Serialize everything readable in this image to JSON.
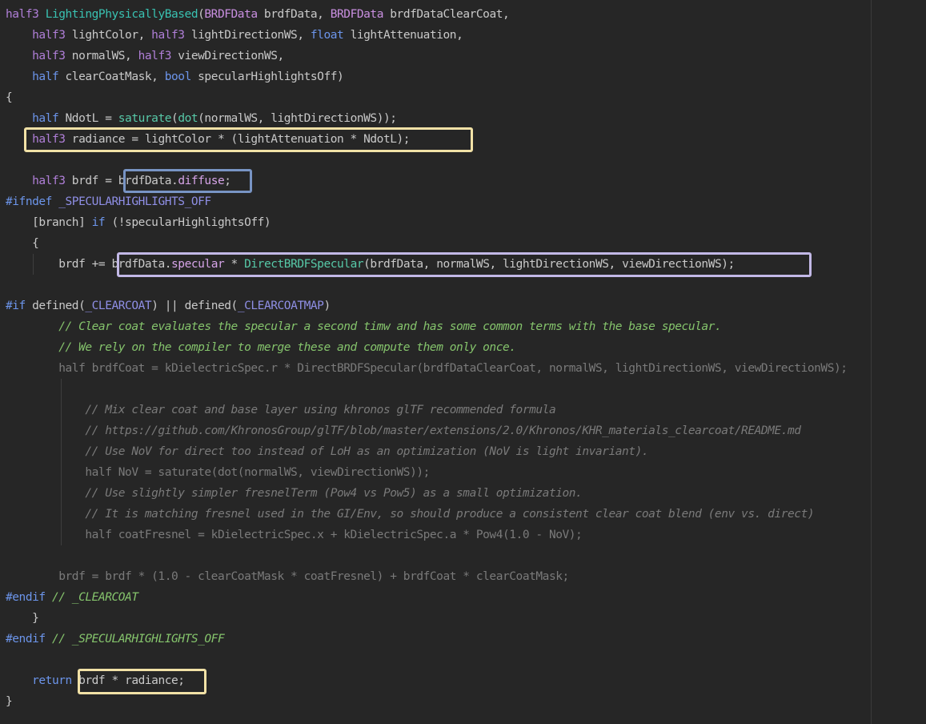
{
  "colors": {
    "background": "#262626",
    "highlight_yellow": "#f1e1a6",
    "highlight_blue": "#7894c4",
    "highlight_lavender": "#c2b8e6"
  },
  "lines": [
    [
      {
        "t": "half3 ",
        "c": "kw"
      },
      {
        "t": "LightingPhysicallyBased",
        "c": "fndecl"
      },
      {
        "t": "(",
        "c": "plain"
      },
      {
        "t": "BRDFData",
        "c": "type"
      },
      {
        "t": " brdfData, ",
        "c": "plain"
      },
      {
        "t": "BRDFData",
        "c": "type"
      },
      {
        "t": " brdfDataClearCoat,",
        "c": "plain"
      }
    ],
    [
      {
        "t": "    ",
        "c": "plain"
      },
      {
        "t": "half3",
        "c": "kw"
      },
      {
        "t": " lightColor, ",
        "c": "plain"
      },
      {
        "t": "half3",
        "c": "kw"
      },
      {
        "t": " lightDirectionWS, ",
        "c": "plain"
      },
      {
        "t": "float",
        "c": "blue"
      },
      {
        "t": " lightAttenuation,",
        "c": "plain"
      }
    ],
    [
      {
        "t": "    ",
        "c": "plain"
      },
      {
        "t": "half3",
        "c": "kw"
      },
      {
        "t": " normalWS, ",
        "c": "plain"
      },
      {
        "t": "half3",
        "c": "kw"
      },
      {
        "t": " viewDirectionWS,",
        "c": "plain"
      }
    ],
    [
      {
        "t": "    ",
        "c": "plain"
      },
      {
        "t": "half",
        "c": "blue"
      },
      {
        "t": " clearCoatMask, ",
        "c": "plain"
      },
      {
        "t": "bool",
        "c": "blue"
      },
      {
        "t": " specularHighlightsOff)",
        "c": "plain"
      }
    ],
    [
      {
        "t": "{",
        "c": "plain"
      }
    ],
    [
      {
        "t": "    ",
        "c": "plain"
      },
      {
        "t": "half",
        "c": "blue"
      },
      {
        "t": " NdotL = ",
        "c": "plain"
      },
      {
        "t": "saturate",
        "c": "fn"
      },
      {
        "t": "(",
        "c": "plain"
      },
      {
        "t": "dot",
        "c": "fn"
      },
      {
        "t": "(normalWS, lightDirectionWS));",
        "c": "plain"
      }
    ],
    [
      {
        "t": "    ",
        "c": "plain"
      },
      {
        "t": "half3",
        "c": "kw"
      },
      {
        "t": " radiance = lightColor * (lightAttenuation * NdotL);",
        "c": "plain"
      }
    ],
    [
      {
        "t": "",
        "c": "plain"
      }
    ],
    [
      {
        "t": "    ",
        "c": "plain"
      },
      {
        "t": "half3",
        "c": "kw"
      },
      {
        "t": " brdf = ",
        "c": "plain"
      },
      {
        "t": "brdfData.",
        "c": "plain"
      },
      {
        "t": "diffuse",
        "c": "field"
      },
      {
        "t": ";",
        "c": "plain"
      }
    ],
    [
      {
        "t": "#ifndef",
        "c": "pp"
      },
      {
        "t": " ",
        "c": "plain"
      },
      {
        "t": "_SPECULARHIGHLIGHTS_OFF",
        "c": "macro"
      }
    ],
    [
      {
        "t": "    [branch] ",
        "c": "plain"
      },
      {
        "t": "if",
        "c": "blue"
      },
      {
        "t": " (!specularHighlightsOff)",
        "c": "plain"
      }
    ],
    [
      {
        "t": "    {",
        "c": "plain"
      }
    ],
    [
      {
        "t": "        brdf += ",
        "c": "plain"
      },
      {
        "t": "brdfData.",
        "c": "plain"
      },
      {
        "t": "specular",
        "c": "field"
      },
      {
        "t": " * ",
        "c": "plain"
      },
      {
        "t": "DirectBRDFSpecular",
        "c": "fn"
      },
      {
        "t": "(brdfData, normalWS, lightDirectionWS, viewDirectionWS);",
        "c": "plain"
      }
    ],
    [
      {
        "t": "",
        "c": "plain"
      }
    ],
    [
      {
        "t": "#if",
        "c": "pp"
      },
      {
        "t": " defined(",
        "c": "plain"
      },
      {
        "t": "_CLEARCOAT",
        "c": "macro"
      },
      {
        "t": ") || defined(",
        "c": "plain"
      },
      {
        "t": "_CLEARCOATMAP",
        "c": "macro"
      },
      {
        "t": ")",
        "c": "plain"
      }
    ],
    [
      {
        "t": "        ",
        "c": "plain"
      },
      {
        "t": "// Clear coat evaluates the specular a second timw and has some common terms with the base specular.",
        "c": "cmt"
      }
    ],
    [
      {
        "t": "        ",
        "c": "plain"
      },
      {
        "t": "// We rely on the compiler to merge these and compute them only once.",
        "c": "cmt"
      }
    ],
    [
      {
        "t": "        half brdfCoat = kDielectricSpec.r * DirectBRDFSpecular(brdfDataClearCoat, normalWS, lightDirectionWS, viewDirectionWS);",
        "c": "dim"
      }
    ],
    [
      {
        "t": "",
        "c": "plain"
      }
    ],
    [
      {
        "t": "            ",
        "c": "plain"
      },
      {
        "t": "// Mix clear coat and base layer using khronos glTF recommended formula",
        "c": "dimcmt"
      }
    ],
    [
      {
        "t": "            ",
        "c": "plain"
      },
      {
        "t": "// https://github.com/KhronosGroup/glTF/blob/master/extensions/2.0/Khronos/KHR_materials_clearcoat/README.md",
        "c": "dimcmt"
      }
    ],
    [
      {
        "t": "            ",
        "c": "plain"
      },
      {
        "t": "// Use NoV for direct too instead of LoH as an optimization (NoV is light invariant).",
        "c": "dimcmt"
      }
    ],
    [
      {
        "t": "            half NoV = saturate(dot(normalWS, viewDirectionWS));",
        "c": "dim"
      }
    ],
    [
      {
        "t": "            ",
        "c": "plain"
      },
      {
        "t": "// Use slightly simpler fresnelTerm (Pow4 vs Pow5) as a small optimization.",
        "c": "dimcmt"
      }
    ],
    [
      {
        "t": "            ",
        "c": "plain"
      },
      {
        "t": "// It is matching fresnel used in the GI/Env, so should produce a consistent clear coat blend (env vs. direct)",
        "c": "dimcmt"
      }
    ],
    [
      {
        "t": "            half coatFresnel = kDielectricSpec.x + kDielectricSpec.a * Pow4(1.0 - NoV);",
        "c": "dim"
      }
    ],
    [
      {
        "t": "",
        "c": "plain"
      }
    ],
    [
      {
        "t": "        brdf = brdf * (1.0 - clearCoatMask * coatFresnel) + brdfCoat * clearCoatMask;",
        "c": "dim"
      }
    ],
    [
      {
        "t": "#endif",
        "c": "pp"
      },
      {
        "t": " ",
        "c": "plain"
      },
      {
        "t": "// _CLEARCOAT",
        "c": "cmt"
      }
    ],
    [
      {
        "t": "    }",
        "c": "plain"
      }
    ],
    [
      {
        "t": "#endif",
        "c": "pp"
      },
      {
        "t": " ",
        "c": "plain"
      },
      {
        "t": "// _SPECULARHIGHLIGHTS_OFF",
        "c": "cmt"
      }
    ],
    [
      {
        "t": "",
        "c": "plain"
      }
    ],
    [
      {
        "t": "    ",
        "c": "plain"
      },
      {
        "t": "return",
        "c": "blue"
      },
      {
        "t": " brdf * radiance;",
        "c": "plain"
      }
    ],
    [
      {
        "t": "}",
        "c": "plain"
      }
    ]
  ]
}
